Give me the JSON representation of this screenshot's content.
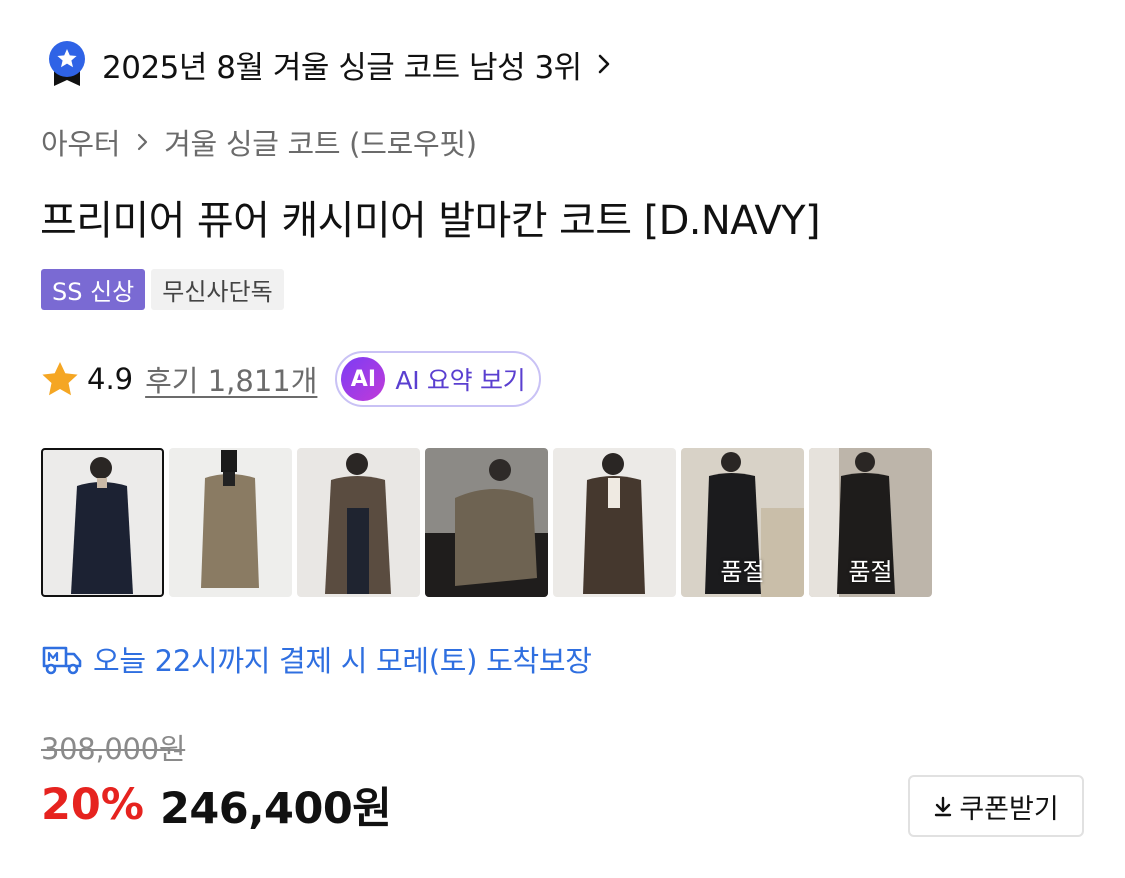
{
  "ranking": {
    "text": "2025년 8월 겨울 싱글 코트 남성 3위"
  },
  "breadcrumb": {
    "items": [
      "아우터",
      "겨울 싱글 코트 (드로우핏)"
    ]
  },
  "product": {
    "title": "프리미어 퓨어 캐시미어 발마칸 코트 [D.NAVY]"
  },
  "tags": [
    "SS 신상",
    "무신사단독"
  ],
  "rating": {
    "score": "4.9",
    "reviews_label": "후기 1,811개"
  },
  "ai_summary": {
    "badge": "AI",
    "label": "AI 요약 보기"
  },
  "thumbnails": [
    {
      "sold_out": ""
    },
    {
      "sold_out": ""
    },
    {
      "sold_out": ""
    },
    {
      "sold_out": ""
    },
    {
      "sold_out": ""
    },
    {
      "sold_out": "품절"
    },
    {
      "sold_out": "품절"
    }
  ],
  "delivery": {
    "text": "오늘 22시까지 결제 시 모레(토) 도착보장"
  },
  "price": {
    "original": "308,000원",
    "discount": "20%",
    "sale": "246,400원"
  },
  "coupon": {
    "label": "쿠폰받기"
  },
  "colors": {
    "ss_tag": "#7a6ad3",
    "delivery_blue": "#2f6fe0",
    "discount_red": "#e6231f",
    "star": "#f5a623",
    "ai_purple": "#5a3fd0"
  }
}
